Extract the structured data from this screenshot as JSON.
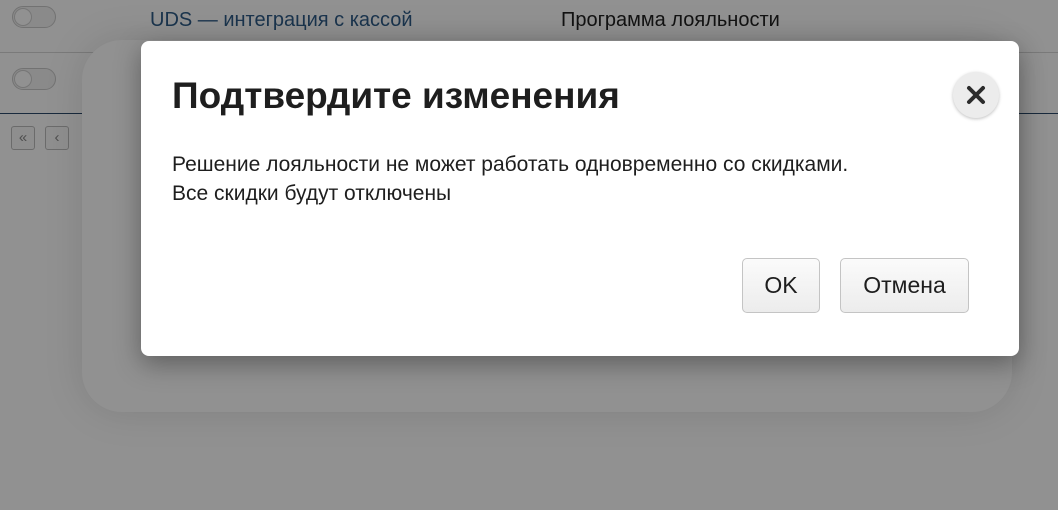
{
  "background": {
    "integrations": [
      {
        "name": "UDS — интеграция с кассой",
        "type": "Программа лояльности"
      },
      {
        "name": "",
        "type": ""
      }
    ],
    "pager": {
      "first_label": "«",
      "prev_label": "‹"
    }
  },
  "dialog": {
    "title": "Подтвердите изменения",
    "message": "Решение лояльности не может работать одновременно со скидками. Все скидки будут отключены",
    "ok_label": "OK",
    "cancel_label": "Отмена",
    "close_icon": "close-icon"
  },
  "colors": {
    "link": "#2f5d89",
    "overlay": "rgba(0,0,0,0.43)",
    "dialog_bg": "#ffffff"
  }
}
